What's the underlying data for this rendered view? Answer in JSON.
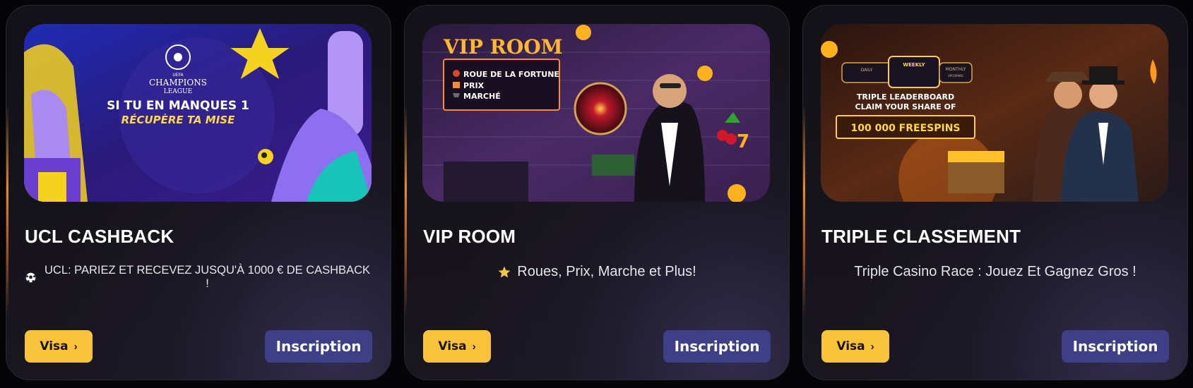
{
  "cards": [
    {
      "title": "UCL CASHBACK",
      "description": "UCL: PARIEZ ET RECEVEZ JUSQU'À 1000 € DE CASHBACK !",
      "desc_icon": "soccer-ball-icon",
      "visa_label": "Visa",
      "signup_label": "Inscription",
      "banner": {
        "league_top": "UEFA",
        "league_name": "CHAMPIONS",
        "league_sub": "LEAGUE",
        "line1": "SI TU EN MANQUES 1",
        "line2": "RÉCUPÈRE TA MISE"
      }
    },
    {
      "title": "VIP ROOM",
      "description": "Roues, Prix, Marche et Plus!",
      "desc_icon": "star-icon",
      "visa_label": "Visa",
      "signup_label": "Inscription",
      "banner": {
        "heading": "VIP ROOM",
        "items": [
          "ROUE DE LA FORTUNE",
          "PRIX",
          "MARCHÉ"
        ]
      }
    },
    {
      "title": "TRIPLE CLASSEMENT",
      "description": "Triple Casino Race : Jouez Et Gagnez Gros !",
      "visa_label": "Visa",
      "signup_label": "Inscription",
      "banner": {
        "tab_daily": "DAILY",
        "tab_weekly": "WEEKLY",
        "tab_monthly": "MONTHLY",
        "tab_monthly_sub": "UPCOMING",
        "line1": "TRIPLE LEADERBOARD",
        "line2": "CLAIM YOUR SHARE OF",
        "prize": "100 000 FREESPINS"
      }
    }
  ],
  "colors": {
    "visa_button": "#f8c33a",
    "signup_button": "#3e3f86",
    "card_bg": "#15131a",
    "page_bg": "#050507"
  }
}
